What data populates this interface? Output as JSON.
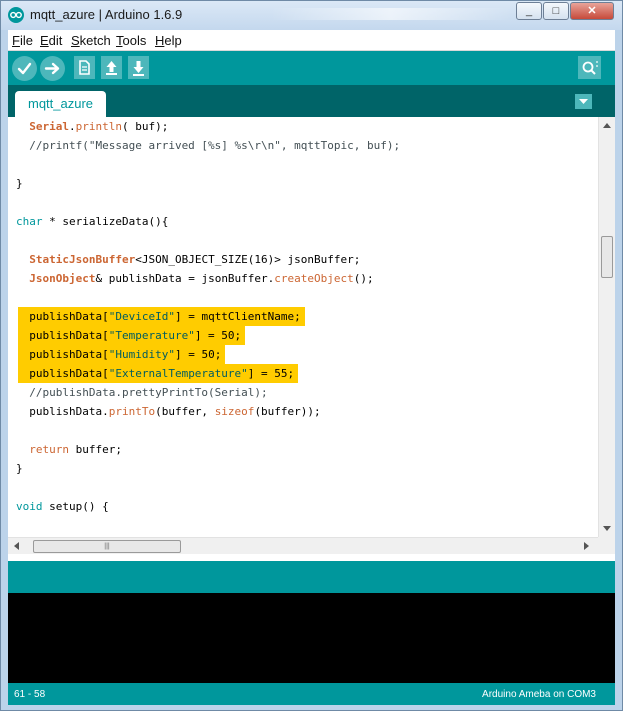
{
  "window": {
    "title": "mqtt_azure | Arduino 1.6.9",
    "min_glyph": "_",
    "max_glyph": "□",
    "close_glyph": "✕"
  },
  "menu": [
    {
      "underline": "F",
      "rest": "ile"
    },
    {
      "underline": "E",
      "rest": "dit"
    },
    {
      "underline": "S",
      "rest": "ketch"
    },
    {
      "underline": "T",
      "rest": "ools"
    },
    {
      "underline": "H",
      "rest": "elp"
    }
  ],
  "toolbar": {
    "icons": [
      "verify-icon",
      "upload-icon",
      "new-icon",
      "open-icon",
      "save-icon",
      "serial-monitor-icon"
    ]
  },
  "tabs": {
    "active": "mqtt_azure",
    "menu_icon": "tab-menu-icon"
  },
  "code_lines": [
    {
      "segments": [
        {
          "t": "  "
        },
        {
          "t": "Serial",
          "c": "kw-obj"
        },
        {
          "t": "."
        },
        {
          "t": "println",
          "c": "kw-fn"
        },
        {
          "t": "( buf);"
        }
      ]
    },
    {
      "segments": [
        {
          "t": "  //printf(\"Message arrived [%s] %s\\r\\n\", mqttTopic, buf);",
          "c": "cmt"
        }
      ]
    },
    {
      "segments": [
        {
          "t": ""
        }
      ]
    },
    {
      "segments": [
        {
          "t": "}"
        }
      ]
    },
    {
      "segments": [
        {
          "t": ""
        }
      ]
    },
    {
      "segments": [
        {
          "t": "char",
          "c": "kw-type"
        },
        {
          "t": " * serializeData(){"
        }
      ]
    },
    {
      "segments": [
        {
          "t": ""
        }
      ]
    },
    {
      "segments": [
        {
          "t": "  "
        },
        {
          "t": "StaticJsonBuffer",
          "c": "kw-obj"
        },
        {
          "t": "<JSON_OBJECT_SIZE(16)> jsonBuffer;"
        }
      ]
    },
    {
      "segments": [
        {
          "t": "  "
        },
        {
          "t": "JsonObject",
          "c": "kw-obj"
        },
        {
          "t": "& publishData = jsonBuffer."
        },
        {
          "t": "createObject",
          "c": "kw-fn"
        },
        {
          "t": "();"
        }
      ]
    },
    {
      "segments": [
        {
          "t": ""
        }
      ]
    },
    {
      "segments": [
        {
          "t": "  publishData["
        },
        {
          "t": "\"DeviceId\"",
          "c": "str"
        },
        {
          "t": "] = mqttClientName;"
        }
      ],
      "highlight": true
    },
    {
      "segments": [
        {
          "t": "  publishData["
        },
        {
          "t": "\"Temperature\"",
          "c": "str"
        },
        {
          "t": "] = 50;"
        }
      ],
      "highlight": true
    },
    {
      "segments": [
        {
          "t": "  publishData["
        },
        {
          "t": "\"Humidity\"",
          "c": "str"
        },
        {
          "t": "] = 50;"
        }
      ],
      "highlight": true
    },
    {
      "segments": [
        {
          "t": "  publishData["
        },
        {
          "t": "\"ExternalTemperature\"",
          "c": "str"
        },
        {
          "t": "] = 55;"
        }
      ],
      "highlight": true
    },
    {
      "segments": [
        {
          "t": "  //publishData.prettyPrintTo(Serial);",
          "c": "cmt"
        }
      ]
    },
    {
      "segments": [
        {
          "t": "  publishData."
        },
        {
          "t": "printTo",
          "c": "kw-fn"
        },
        {
          "t": "(buffer, "
        },
        {
          "t": "sizeof",
          "c": "kw-fn"
        },
        {
          "t": "(buffer));"
        }
      ]
    },
    {
      "segments": [
        {
          "t": ""
        }
      ]
    },
    {
      "segments": [
        {
          "t": "  "
        },
        {
          "t": "return",
          "c": "kw-fn"
        },
        {
          "t": " buffer;"
        }
      ]
    },
    {
      "segments": [
        {
          "t": "}"
        }
      ]
    },
    {
      "segments": [
        {
          "t": ""
        }
      ]
    },
    {
      "segments": [
        {
          "t": "void",
          "c": "kw-type"
        },
        {
          "t": " setup() {"
        }
      ]
    }
  ],
  "scrollbar": {
    "h_thumb_grip": "|||"
  },
  "footer": {
    "line": "61 - 58",
    "board": "Arduino Ameba on COM3"
  },
  "colors": {
    "accent": "#00979c",
    "tab_bar": "#006468",
    "highlight": "#ffcc00",
    "console": "#000000"
  }
}
